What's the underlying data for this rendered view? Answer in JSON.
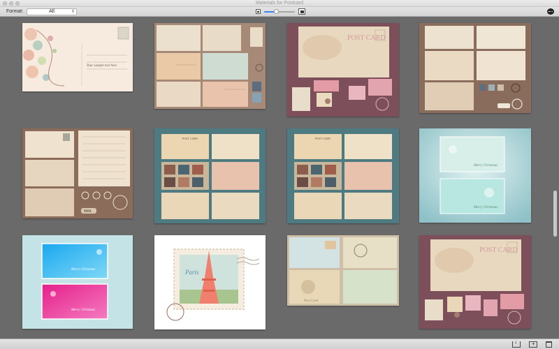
{
  "window": {
    "title": "Materials for Postcard"
  },
  "toolbar": {
    "format_label": "Format:",
    "format_value": "All",
    "thumb_size_level": 0.4
  },
  "icons": {
    "small_size": "small-image-icon",
    "large_size": "large-image-icon",
    "chat": "chat-bubble-icon",
    "export": "download-icon",
    "new_folder": "new-folder-icon",
    "delete": "trash-icon"
  },
  "colors": {
    "accent": "#3b86f5",
    "grid_bg": "#6a6a6a"
  },
  "grid": {
    "items": [
      {
        "label": "Vintage floral postcard",
        "text": "Your sample text here"
      },
      {
        "label": "Vintage postcard set brown"
      },
      {
        "label": "Post card stamps mauve",
        "text": "POST CARD"
      },
      {
        "label": "Postcard set brown"
      },
      {
        "label": "Envelopes and letter",
        "text": "MAIL"
      },
      {
        "label": "Teal postcards with stamps 1",
        "text": "POST CARD"
      },
      {
        "label": "Teal postcards with stamps 2",
        "text": "POST CARD"
      },
      {
        "label": "Christmas cards blue",
        "text": "Merry Christmas"
      },
      {
        "label": "Christmas cards pink",
        "text": "Merry Christmas"
      },
      {
        "label": "Paris Eiffel stamp",
        "text": "Paris"
      },
      {
        "label": "Vintage postcards green",
        "text": "Post Card"
      },
      {
        "label": "Postcard mauve with stamps",
        "text": "POST CARD"
      }
    ]
  }
}
